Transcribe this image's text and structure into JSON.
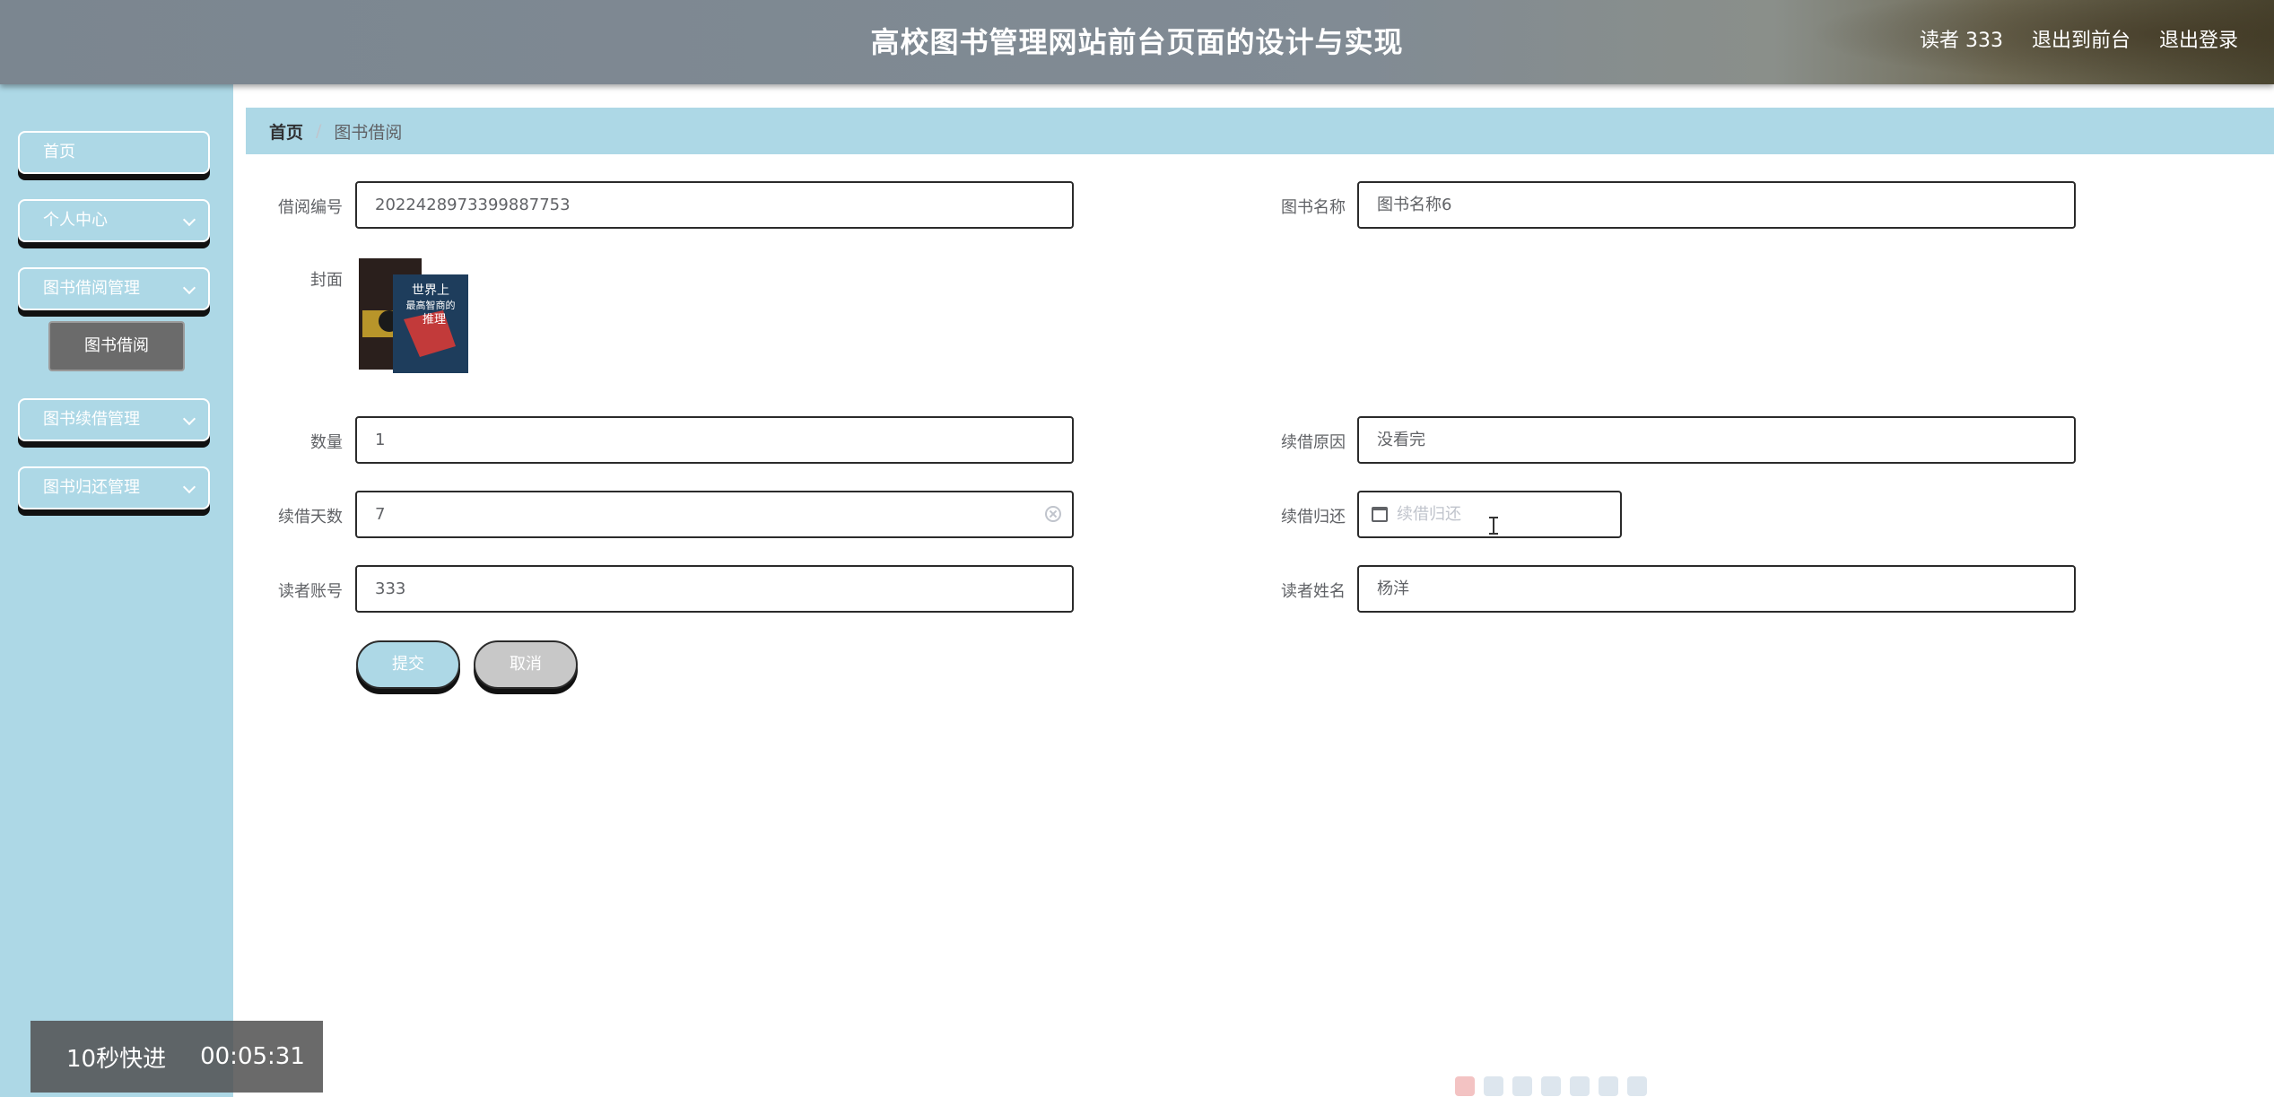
{
  "header": {
    "title": "高校图书管理网站前台页面的设计与实现",
    "user_label": "读者 333",
    "front_link": "退出到前台",
    "logout_link": "退出登录"
  },
  "sidebar": {
    "items": [
      {
        "label": "首页"
      },
      {
        "label": "个人中心"
      },
      {
        "label": "图书借阅管理"
      },
      {
        "label": "图书续借管理"
      },
      {
        "label": "图书归还管理"
      }
    ],
    "sub_item": "图书借阅"
  },
  "breadcrumb": {
    "home": "首页",
    "separator": "/",
    "current": "图书借阅"
  },
  "form": {
    "borrow_no": {
      "label": "借阅编号",
      "value": "2022428973399887753"
    },
    "book_name": {
      "label": "图书名称",
      "value": "图书名称6"
    },
    "cover": {
      "label": "封面",
      "texts": [
        "世界上",
        "最高智商的",
        "推理"
      ]
    },
    "quantity": {
      "label": "数量",
      "value": "1"
    },
    "renew_reason": {
      "label": "续借原因",
      "value": "没看完"
    },
    "renew_days": {
      "label": "续借天数",
      "value": "7"
    },
    "renew_return": {
      "label": "续借归还",
      "placeholder": "续借归还"
    },
    "reader_account": {
      "label": "读者账号",
      "value": "333"
    },
    "reader_name": {
      "label": "读者姓名",
      "value": "杨洋"
    },
    "submit": "提交",
    "cancel": "取消"
  },
  "overlay": {
    "fast_forward": "10秒快进",
    "time": "00:05:31"
  },
  "colors": {
    "accent": "#add8e6",
    "header": "#818b94",
    "submenu": "#6b6b6b"
  }
}
